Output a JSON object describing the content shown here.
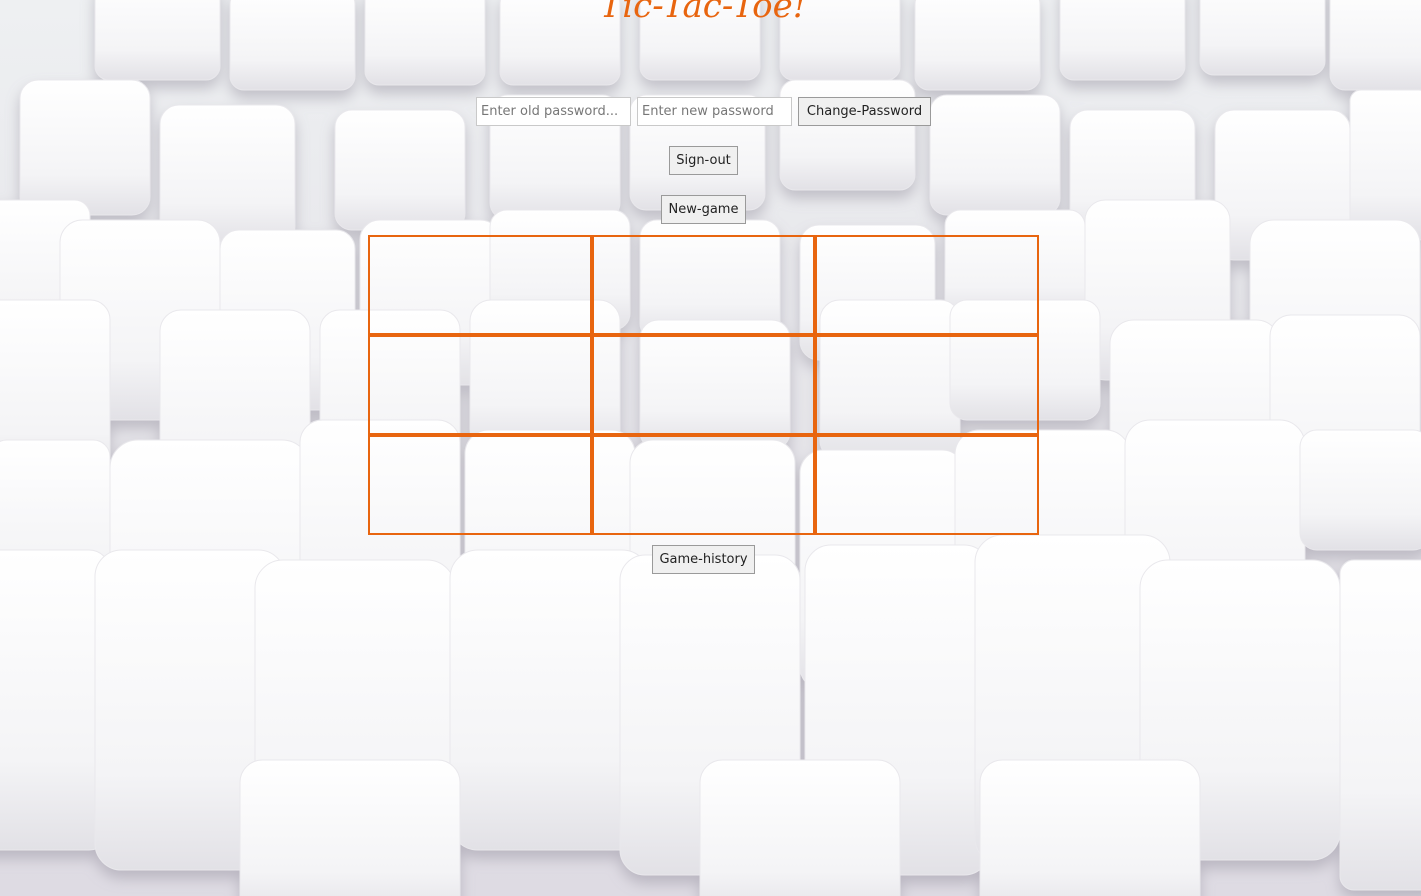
{
  "app": {
    "title": "Tic-Tac-Toe!",
    "accent_color": "#e8650f"
  },
  "account": {
    "old_password_placeholder": "Enter old password...",
    "new_password_placeholder": "Enter new password",
    "change_password_label": "Change-Password",
    "sign_out_label": "Sign-out"
  },
  "game": {
    "new_game_label": "New-game",
    "history_label": "Game-history",
    "board": [
      "",
      "",
      "",
      "",
      "",
      "",
      "",
      "",
      ""
    ]
  }
}
